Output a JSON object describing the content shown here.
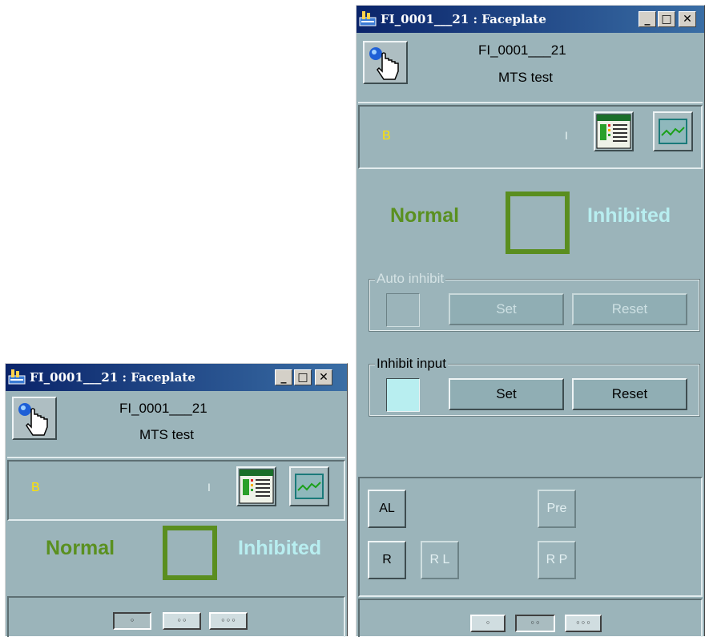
{
  "window_small": {
    "title": "FI_0001___21 : Faceplate",
    "controls": {
      "minimize": "_",
      "maximize": "□",
      "close": "✕"
    },
    "tag_name": "FI_0001___21",
    "description": "MTS test",
    "indicator_letter": "B",
    "indicator_tick": "I",
    "state_left": "Normal",
    "state_right": "Inhibited",
    "view_buttons": [
      "◦",
      "◦◦",
      "◦◦◦"
    ]
  },
  "window_large": {
    "title": "FI_0001___21 : Faceplate",
    "controls": {
      "minimize": "_",
      "maximize": "□",
      "close": "✕"
    },
    "tag_name": "FI_0001___21",
    "description": "MTS test",
    "indicator_letter": "B",
    "indicator_tick": "I",
    "state_left": "Normal",
    "state_right": "Inhibited",
    "auto_inhibit": {
      "label": "Auto inhibit",
      "set": "Set",
      "reset": "Reset"
    },
    "inhibit_input": {
      "label": "Inhibit input",
      "set": "Set",
      "reset": "Reset"
    },
    "bottom_buttons": {
      "al": "AL",
      "pre": "Pre",
      "r": "R",
      "rl": "R L",
      "rp": "R P"
    },
    "view_buttons": [
      "◦",
      "◦◦",
      "◦◦◦"
    ]
  },
  "colors": {
    "normal": "#5a9020",
    "inhibited": "#b8eef0",
    "indicator": "#ffe200",
    "panel": "#9bb4ba"
  }
}
